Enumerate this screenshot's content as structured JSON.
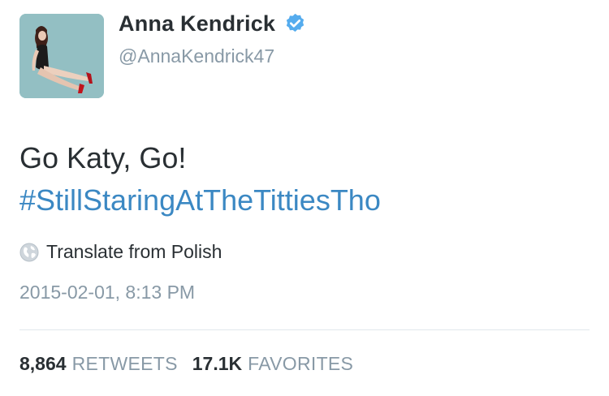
{
  "profile": {
    "name": "Anna Kendrick",
    "handle": "@AnnaKendrick47",
    "verified": true,
    "avatar_icon": "profile-photo"
  },
  "tweet": {
    "line1": "Go Katy, Go!",
    "hashtag": "#StillStaringAtTheTittiesTho",
    "hashtag_color": "#3b88c3"
  },
  "translate": {
    "icon": "globe-icon",
    "label": "Translate from Polish"
  },
  "timestamp": "2015-02-01, 8:13 PM",
  "stats": {
    "retweets_count": "8,864",
    "retweets_label": "RETWEETS",
    "favorites_count": "17.1K",
    "favorites_label": "FAVORITES"
  },
  "colors": {
    "text": "#292f33",
    "muted": "#8899a6",
    "verified_badge": "#55acee",
    "divider": "#e1e8ed"
  }
}
